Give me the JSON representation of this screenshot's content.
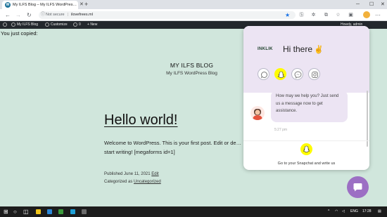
{
  "browser": {
    "tab_title": "My ILFS Blog – My ILFS WordPres…",
    "address": {
      "security_label": "Not secure",
      "url": "ilovefrees.ml"
    }
  },
  "adminbar": {
    "site_label": "My ILFS Blog",
    "customize_label": "Customize",
    "comments_count": "0",
    "new_label": "New",
    "howdy_label": "Howdy, admin"
  },
  "page": {
    "copied_label": "You just copied:",
    "site_title": "MY ILFS BLOG",
    "site_description": "My ILFS WordPress Blog",
    "post_title": "Hello world!",
    "post_body": "Welcome to WordPress. This is your first post. Edit or de… start writing! [megaforms id=1]",
    "published_prefix": "Published June 11, 2021",
    "edit_link": "Edit",
    "categorized_prefix": "Categorized as",
    "category_link": "Uncategorized"
  },
  "widget": {
    "logo_text": "INKLIK",
    "greeting": "Hi there",
    "greeting_emoji": "✌",
    "channels": [
      {
        "name": "whatsapp",
        "active": false
      },
      {
        "name": "snapchat",
        "active": true
      },
      {
        "name": "messenger",
        "active": false
      },
      {
        "name": "instagram",
        "active": false
      }
    ],
    "message": "How may we help you? Just send us a message now to get assistance.",
    "message_time": "5:27 pm",
    "cta_label": "Go to your Snapchat and write us",
    "accent_color": "#ece4f3",
    "snapchat_color": "#fffc00",
    "fab_color": "#9c6fc4"
  },
  "taskbar": {
    "language": "ENG",
    "time": "17:28"
  }
}
